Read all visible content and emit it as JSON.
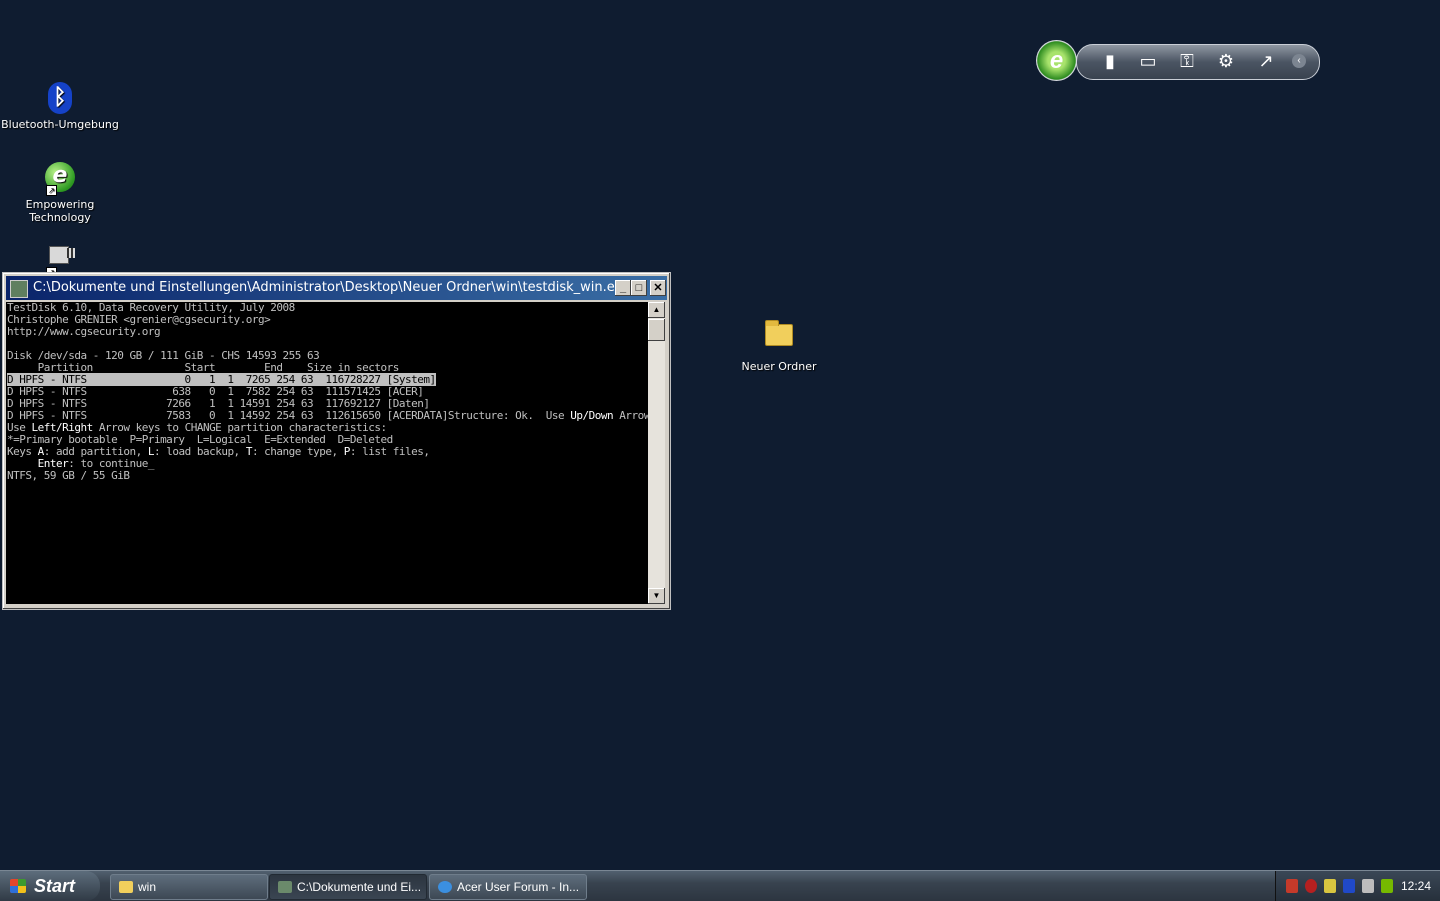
{
  "desktop": {
    "icons": [
      {
        "label": "Bluetooth-Umgebung"
      },
      {
        "label": "Empowering Technology"
      },
      {
        "label": ""
      },
      {
        "label": "Neuer Ordner"
      }
    ]
  },
  "console_window": {
    "title": "C:\\Dokumente und Einstellungen\\Administrator\\Desktop\\Neuer Ordner\\win\\testdisk_win.exe",
    "lines": [
      "TestDisk 6.10, Data Recovery Utility, July 2008",
      "Christophe GRENIER <grenier@cgsecurity.org>",
      "http://www.cgsecurity.org",
      "",
      "Disk /dev/sda - 120 GB / 111 GiB - CHS 14593 255 63",
      "     Partition               Start        End    Size in sectors"
    ],
    "partitions": [
      "D HPFS - NTFS                0   1  1  7265 254 63  116728227 [System]",
      "D HPFS - NTFS              638   0  1  7582 254 63  111571425 [ACER]",
      "D HPFS - NTFS             7266   1  1 14591 254 63  117692127 [Daten]",
      "D HPFS - NTFS             7583   0  1 14592 254 63  112615650 [ACERDATA]"
    ],
    "help": {
      "l1_a": "Structure: Ok.  Use ",
      "l1_b": "Up/Down",
      "l1_c": " Arrow keys to select partition.",
      "l2_a": "Use ",
      "l2_b": "Left/Right",
      "l2_c": " Arrow keys to CHANGE partition characteristics:",
      "l3": "*=Primary bootable  P=Primary  L=Logical  E=Extended  D=Deleted",
      "l4_a": "Keys ",
      "l4_b": "A",
      "l4_c": ": add partition, ",
      "l4_d": "L",
      "l4_e": ": load backup, ",
      "l4_f": "T",
      "l4_g": ": change type, ",
      "l4_h": "P",
      "l4_i": ": list files,",
      "l5_a": "     ",
      "l5_b": "Enter",
      "l5_c": ": to continue_",
      "l6": "NTFS, 59 GB / 55 GiB"
    }
  },
  "taskbar": {
    "start_label": "Start",
    "tasks": [
      {
        "label": "win"
      },
      {
        "label": "C:\\Dokumente und Ei..."
      },
      {
        "label": "Acer User Forum - In..."
      }
    ],
    "clock": "12:24"
  }
}
